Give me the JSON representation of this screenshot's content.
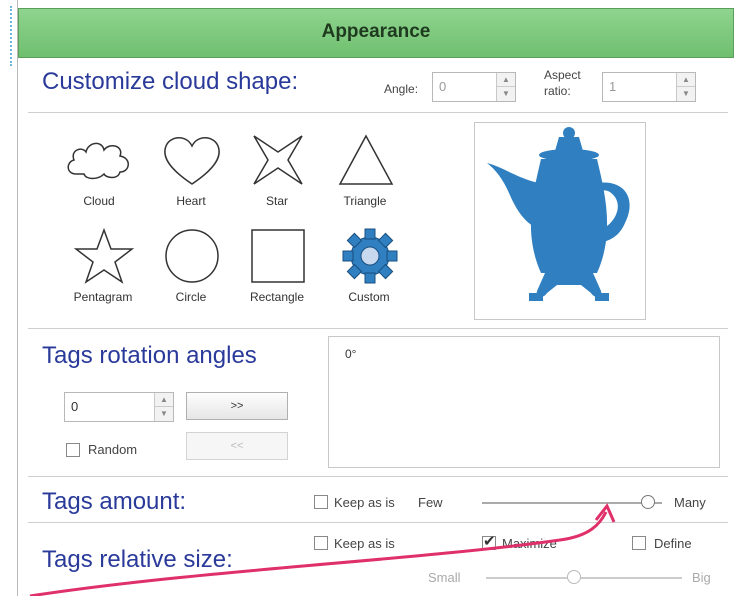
{
  "header": {
    "title": "Appearance"
  },
  "shape_section": {
    "title": "Customize cloud shape:",
    "angle_label": "Angle:",
    "angle_value": "0",
    "aspect_label_1": "Aspect",
    "aspect_label_2": "ratio:",
    "aspect_value": "1",
    "shapes": [
      {
        "label": "Cloud",
        "selected": true,
        "icon": "cloud-icon"
      },
      {
        "label": "Heart",
        "selected": false,
        "icon": "heart-icon"
      },
      {
        "label": "Star",
        "selected": false,
        "icon": "star-icon"
      },
      {
        "label": "Triangle",
        "selected": false,
        "icon": "triangle-icon"
      },
      {
        "label": "Pentagram",
        "selected": false,
        "icon": "pentagram-icon"
      },
      {
        "label": "Circle",
        "selected": false,
        "icon": "circle-icon"
      },
      {
        "label": "Rectangle",
        "selected": false,
        "icon": "rectangle-icon"
      },
      {
        "label": "Custom",
        "selected": true,
        "icon": "gear-icon"
      }
    ],
    "preview_icon": "teapot-icon",
    "preview_color": "#2f7fc1"
  },
  "rotation_section": {
    "title": "Tags rotation angles",
    "angle_value": "0",
    "add_label": ">>",
    "remove_label": "<<",
    "random_label": "Random",
    "random_checked": false,
    "angles_list": [
      "0°"
    ]
  },
  "amount_section": {
    "title": "Tags amount:",
    "keep_label": "Keep as is",
    "keep_checked": false,
    "few_label": "Few",
    "many_label": "Many",
    "slider_level": 0.92
  },
  "size_section": {
    "title": "Tags relative size:",
    "keep_label": "Keep as is",
    "keep_checked": false,
    "maximize_label": "Maximize",
    "maximize_checked": true,
    "define_label": "Define",
    "define_checked": false,
    "small_label": "Small",
    "big_label": "Big",
    "slider_level": 0.45
  },
  "colors": {
    "accent_title": "#2a3a9a",
    "header_green": "#7cc87c",
    "selection": "#c7d8ef",
    "annotation_arrow": "#e0306a"
  }
}
